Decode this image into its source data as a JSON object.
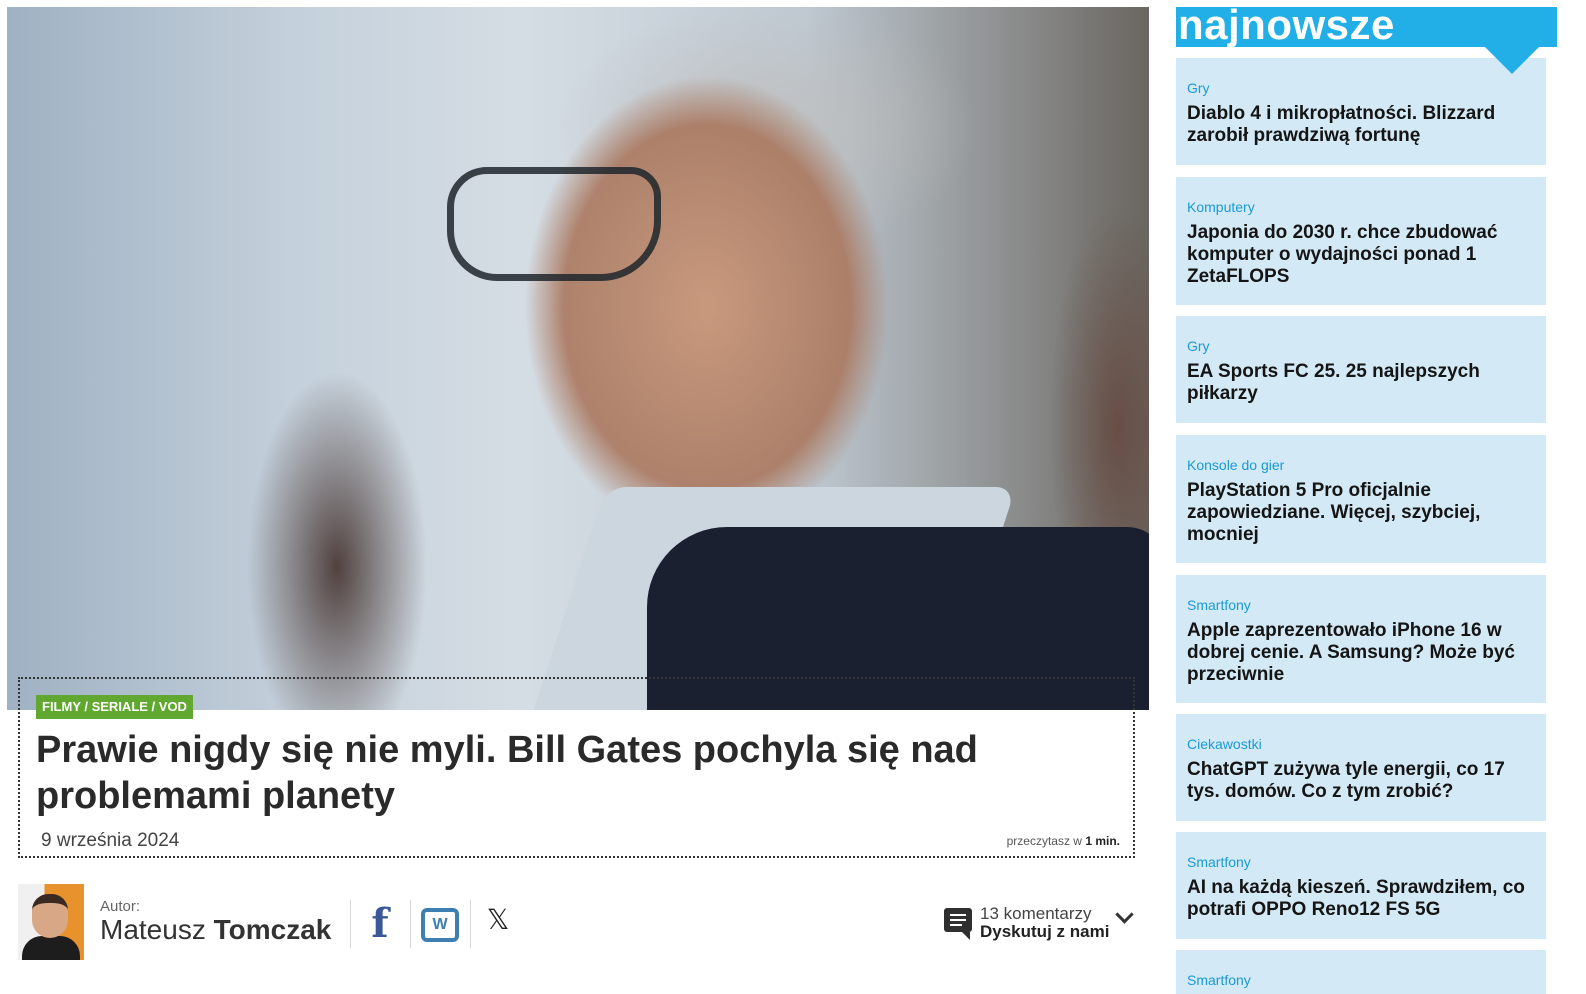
{
  "article": {
    "category": "FILMY / SERIALE / VOD",
    "title": "Prawie nigdy się nie myli. Bill Gates pochyla się nad problemami planety",
    "date": "9 września 2024",
    "read_time_prefix": "przeczytasz w",
    "read_time_value": "1 min."
  },
  "author": {
    "label": "Autor:",
    "first_name": "Mateusz",
    "last_name": "Tomczak"
  },
  "share": {
    "facebook_glyph": "f",
    "wykop_glyph": "W",
    "x_glyph": "𝕏"
  },
  "comments": {
    "count_text": "13 komentarzy",
    "cta": "Dyskutuj z nami"
  },
  "sidebar": {
    "title": "najnowsze",
    "items": [
      {
        "category": "Gry",
        "title": "Diablo 4 i mikropłatności. Blizzard zarobił prawdziwą fortunę"
      },
      {
        "category": "Komputery",
        "title": "Japonia do 2030 r. chce zbudować komputer o wydajności ponad 1 ZetaFLOPS"
      },
      {
        "category": "Gry",
        "title": "EA Sports FC 25. 25 najlepszych piłkarzy"
      },
      {
        "category": "Konsole do gier",
        "title": "PlayStation 5 Pro oficjalnie zapowiedziane. Więcej, szybciej, mocniej"
      },
      {
        "category": "Smartfony",
        "title": "Apple zaprezentowało iPhone 16 w dobrej cenie. A Samsung? Może być przeciwnie"
      },
      {
        "category": "Ciekawostki",
        "title": "ChatGPT zużywa tyle energii, co 17 tys. domów. Co z tym zrobić?"
      },
      {
        "category": "Smartfony",
        "title": "AI na każdą kieszeń. Sprawdziłem, co potrafi OPPO Reno12 FS 5G"
      },
      {
        "category": "Smartfony",
        "title": ""
      }
    ]
  },
  "colors": {
    "accent": "#22aee6",
    "card_bg": "#d3e9f5",
    "badge": "#61a830"
  }
}
